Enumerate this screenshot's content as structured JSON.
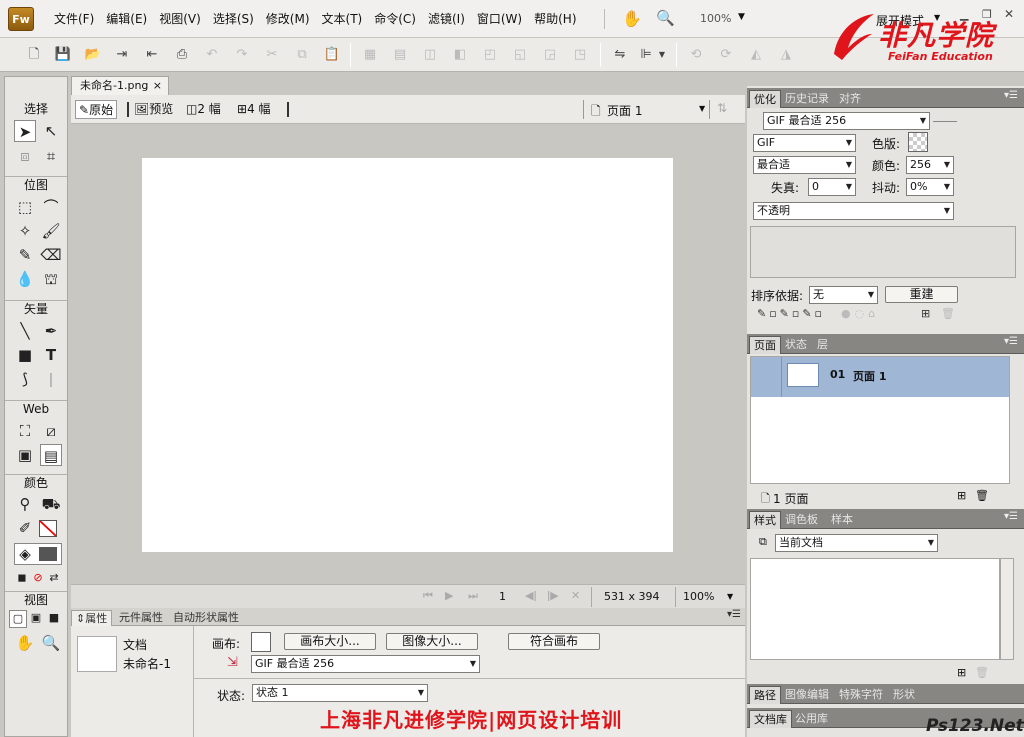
{
  "app": {
    "logo": "Fw",
    "workspace": "展开模式",
    "zoom": "100%"
  },
  "menus": [
    "文件(F)",
    "编辑(E)",
    "视图(V)",
    "选择(S)",
    "修改(M)",
    "文本(T)",
    "命令(C)",
    "滤镜(I)",
    "窗口(W)",
    "帮助(H)"
  ],
  "watermark": {
    "cn": "非凡学院",
    "en": "FeiFan Education",
    "footer": "上海非凡进修学院|网页设计培训",
    "ps": "Ps123.Net"
  },
  "tools": {
    "select": "选择",
    "bitmap": "位图",
    "vector": "矢量",
    "web": "Web",
    "colors": "颜色",
    "view": "视图"
  },
  "document": {
    "tab": "未命名-1.png",
    "close": "×",
    "modes": [
      "原始",
      "预览",
      "2 幅",
      "4 幅"
    ],
    "page": "页面 1"
  },
  "status": {
    "frame": "1",
    "size": "531 x 394",
    "zoom": "100%"
  },
  "properties": {
    "tabs": [
      "属性",
      "元件属性",
      "自动形状属性"
    ],
    "type": "文档",
    "name": "未命名-1",
    "canvas_label": "画布:",
    "canvas_size_btn": "画布大小...",
    "image_size_btn": "图像大小...",
    "fit_btn": "符合画布",
    "export": "GIF 最合适 256",
    "state_label": "状态:",
    "state": "状态 1"
  },
  "optimize": {
    "tabs": [
      "优化",
      "历史记录",
      "对齐"
    ],
    "preset": "GIF 最合适 256",
    "format": "GIF",
    "matte_label": "色版:",
    "palette": "最合适",
    "colors_label": "颜色:",
    "colors": "256",
    "loss_label": "失真:",
    "loss": "0",
    "dither_label": "抖动:",
    "dither": "0%",
    "transparency": "不透明",
    "sort_label": "排序依据:",
    "sort": "无",
    "rebuild": "重建"
  },
  "pages": {
    "tabs": [
      "页面",
      "状态",
      "层"
    ],
    "item_number": "01",
    "item_name": "页面 1",
    "footer": "1 页面"
  },
  "styles": {
    "tabs": [
      "样式",
      "调色板",
      "样本"
    ],
    "current": "当前文档"
  },
  "bottomtabs1": [
    "路径",
    "图像编辑",
    "特殊字符",
    "形状"
  ],
  "bottomtabs2": [
    "文档库",
    "公用库"
  ]
}
